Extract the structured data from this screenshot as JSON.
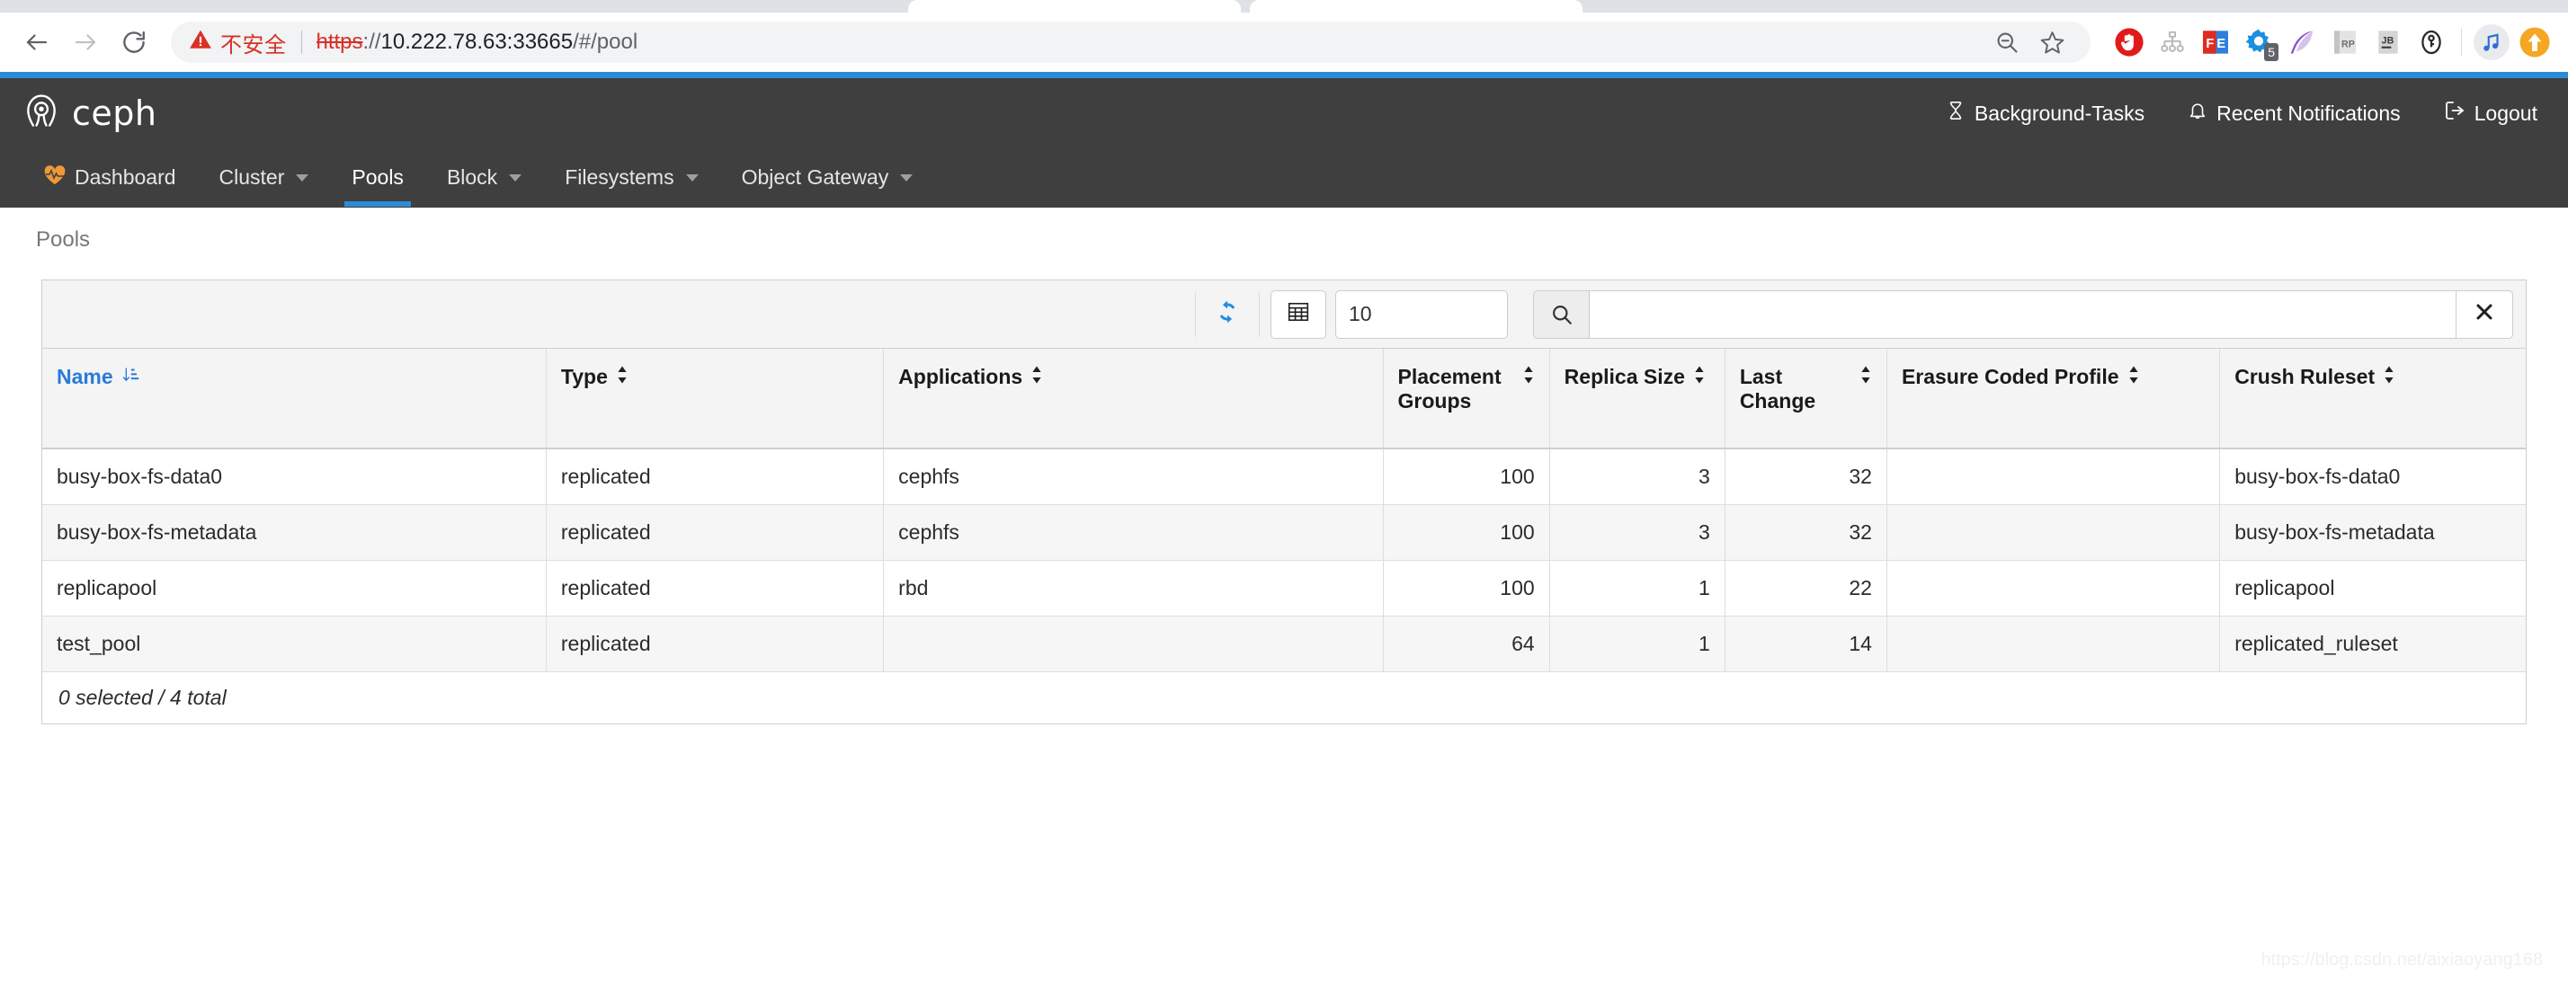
{
  "browser": {
    "back_icon": "back-arrow-icon",
    "forward_icon": "forward-arrow-icon",
    "reload_icon": "reload-icon",
    "security_label": "不安全",
    "url": {
      "scheme": "https",
      "separator": "://",
      "host": "10.222.78.63:33665",
      "path": "/#/pool",
      "full": "https://10.222.78.63:33665/#/pool"
    },
    "actions": [
      {
        "name": "zoom-out-icon",
        "label": "Zoom out"
      },
      {
        "name": "bookmark-star-icon",
        "label": "Bookmark this tab"
      }
    ],
    "extensions": [
      {
        "name": "adblock-stop-hand-icon",
        "label": "AdBlock"
      },
      {
        "name": "sitemap-tree-icon",
        "label": "Sitemap"
      },
      {
        "name": "fe-helper-icon",
        "label": "FE",
        "text": "FE"
      },
      {
        "name": "gear-badge-icon",
        "label": "Settings",
        "badge": "5"
      },
      {
        "name": "feather-pen-icon",
        "label": "Feather"
      },
      {
        "name": "rp-icon",
        "label": "RP",
        "text": "RP"
      },
      {
        "name": "jb-toolbox-icon",
        "label": "JB",
        "text": "JB"
      },
      {
        "name": "key-circle-icon",
        "label": "Password manager"
      }
    ],
    "extensions_after_divider": [
      {
        "name": "music-note-icon",
        "label": "Music"
      },
      {
        "name": "upload-arrow-icon",
        "label": "Upload"
      }
    ]
  },
  "header": {
    "brand": "ceph",
    "brand_logo_icon": "ceph-octopus-logo-icon",
    "links": [
      {
        "icon": "hourglass-icon",
        "label": "Background-Tasks"
      },
      {
        "icon": "bell-icon",
        "label": "Recent Notifications"
      },
      {
        "icon": "sign-out-icon",
        "label": "Logout"
      }
    ]
  },
  "nav": {
    "items": [
      {
        "label": "Dashboard",
        "icon": "heartbeat-icon",
        "has_caret": false,
        "active": false
      },
      {
        "label": "Cluster",
        "icon": "",
        "has_caret": true,
        "active": false
      },
      {
        "label": "Pools",
        "icon": "",
        "has_caret": false,
        "active": true
      },
      {
        "label": "Block",
        "icon": "",
        "has_caret": true,
        "active": false
      },
      {
        "label": "Filesystems",
        "icon": "",
        "has_caret": true,
        "active": false
      },
      {
        "label": "Object Gateway",
        "icon": "",
        "has_caret": true,
        "active": false
      }
    ]
  },
  "breadcrumb": "Pools",
  "toolbar": {
    "refresh_icon": "refresh-icon",
    "grid_icon": "table-columns-icon",
    "limit_value": "10",
    "limit_placeholder": "",
    "search_icon": "search-icon",
    "search_value": "",
    "search_placeholder": "",
    "clear_icon": "close-x-icon"
  },
  "table": {
    "columns": [
      {
        "label": "Name",
        "sorted": true,
        "sort_icon": "sort-amount-asc-icon",
        "align": "left"
      },
      {
        "label": "Type",
        "sorted": false,
        "sort_icon": "sort-icon",
        "align": "left"
      },
      {
        "label": "Applications",
        "sorted": false,
        "sort_icon": "sort-icon",
        "align": "left"
      },
      {
        "label": "Placement Groups",
        "sorted": false,
        "sort_icon": "sort-icon",
        "align": "left"
      },
      {
        "label": "Replica Size",
        "sorted": false,
        "sort_icon": "sort-icon",
        "align": "left"
      },
      {
        "label": "Last Change",
        "sorted": false,
        "sort_icon": "sort-icon",
        "align": "left"
      },
      {
        "label": "Erasure Coded Profile",
        "sorted": false,
        "sort_icon": "sort-icon",
        "align": "left"
      },
      {
        "label": "Crush Ruleset",
        "sorted": false,
        "sort_icon": "sort-icon",
        "align": "left"
      }
    ],
    "rows": [
      {
        "name": "busy-box-fs-data0",
        "type": "replicated",
        "applications": "cephfs",
        "placement_groups": "100",
        "replica_size": "3",
        "last_change": "32",
        "erasure_coded_profile": "",
        "crush_ruleset": "busy-box-fs-data0"
      },
      {
        "name": "busy-box-fs-metadata",
        "type": "replicated",
        "applications": "cephfs",
        "placement_groups": "100",
        "replica_size": "3",
        "last_change": "32",
        "erasure_coded_profile": "",
        "crush_ruleset": "busy-box-fs-metadata"
      },
      {
        "name": "replicapool",
        "type": "replicated",
        "applications": "rbd",
        "placement_groups": "100",
        "replica_size": "1",
        "last_change": "22",
        "erasure_coded_profile": "",
        "crush_ruleset": "replicapool"
      },
      {
        "name": "test_pool",
        "type": "replicated",
        "applications": "",
        "placement_groups": "64",
        "replica_size": "1",
        "last_change": "14",
        "erasure_coded_profile": "",
        "crush_ruleset": "replicated_ruleset"
      }
    ],
    "footer": "0 selected / 4 total"
  },
  "watermark": "https://blog.csdn.net/aixiaoyang168",
  "colors": {
    "accent_blue": "#2b8cd8",
    "header_dark": "#3f3f3f",
    "sorted_link": "#2b7ad8",
    "insecure_red": "#d93025",
    "dashboard_orange": "#f0973a"
  }
}
